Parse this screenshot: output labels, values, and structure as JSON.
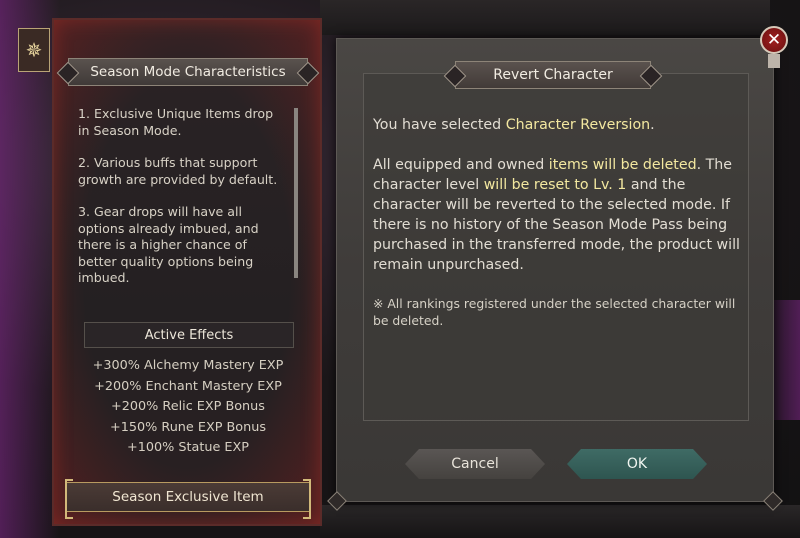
{
  "left_panel": {
    "header": "Season Mode Characteristics",
    "characteristics": [
      "1. Exclusive Unique Items drop in Season Mode.",
      "2. Various buffs that support growth are provided by default.",
      "3. Gear drops will have all options already imbued, and there is a higher chance of better quality options being imbued."
    ],
    "active_effects_header": "Active Effects",
    "effects": [
      "+300% Alchemy Mastery EXP",
      "+200% Enchant Mastery EXP",
      "+200% Relic EXP Bonus",
      "+150% Rune EXP Bonus",
      "+100% Statue EXP"
    ],
    "exclusive_button": "Season Exclusive Item"
  },
  "dialog": {
    "title": "Revert Character",
    "p1_a": "You have selected ",
    "p1_hl": "Character Reversion",
    "p1_b": ".",
    "p2_a": "All equipped and owned ",
    "p2_hl1": "items will be deleted",
    "p2_b": ". The character level ",
    "p2_hl2": "will be reset to Lv. 1",
    "p2_c": " and the character will be reverted to the selected mode. If there is no history of the Season Mode Pass being purchased in the transferred mode, the product will remain unpurchased.",
    "note": "※ All rankings registered under the selected character will be deleted.",
    "cancel_label": "Cancel",
    "ok_label": "OK"
  },
  "close_glyph": "✕",
  "emblem_glyph": "✵",
  "colors": {
    "highlight": "#f3e8a0",
    "ok_button": "#3f6b65",
    "close_button": "#a21f1f"
  }
}
